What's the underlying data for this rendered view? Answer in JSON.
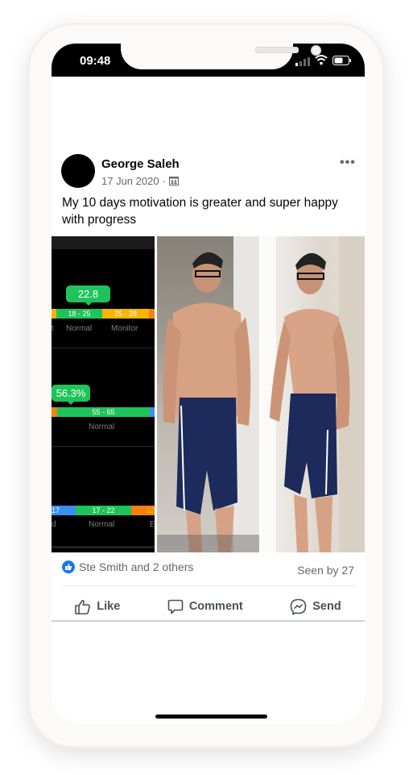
{
  "status_bar": {
    "time": "09:48"
  },
  "post": {
    "author": "George Saleh",
    "date": "17 Jun 2020",
    "separator": "·",
    "audience_icon": "friends-icon",
    "more_icon": "•••",
    "caption": "My 10 days motivation is greater and super happy with progress",
    "photos": {
      "stats": [
        {
          "value": "22.8",
          "bands": [
            "",
            "18 - 25",
            "25 - 28"
          ],
          "labels": [
            "t",
            "Normal",
            "Monitor"
          ]
        },
        {
          "value": "56.3%",
          "bands": [
            "",
            "55 - 65",
            ""
          ],
          "labels": [
            "",
            "Normal",
            ""
          ]
        },
        {
          "value": "",
          "bands": [
            "17",
            "17 - 22",
            "22"
          ],
          "labels": [
            "d",
            "Normal",
            "E"
          ]
        }
      ],
      "colors": {
        "green": "#1ec45a",
        "yellow": "#f7b500",
        "orange": "#f5820a",
        "blue": "#3a8ff0"
      },
      "alt": [
        "body composition stats",
        "progress photo front",
        "progress photo side"
      ]
    },
    "reactions": {
      "text": "Ste Smith and 2 others",
      "seen": "Seen by 27"
    },
    "actions": [
      {
        "label": "Like",
        "icon": "thumbs-up-icon"
      },
      {
        "label": "Comment",
        "icon": "comment-icon"
      },
      {
        "label": "Send",
        "icon": "messenger-icon"
      }
    ]
  }
}
